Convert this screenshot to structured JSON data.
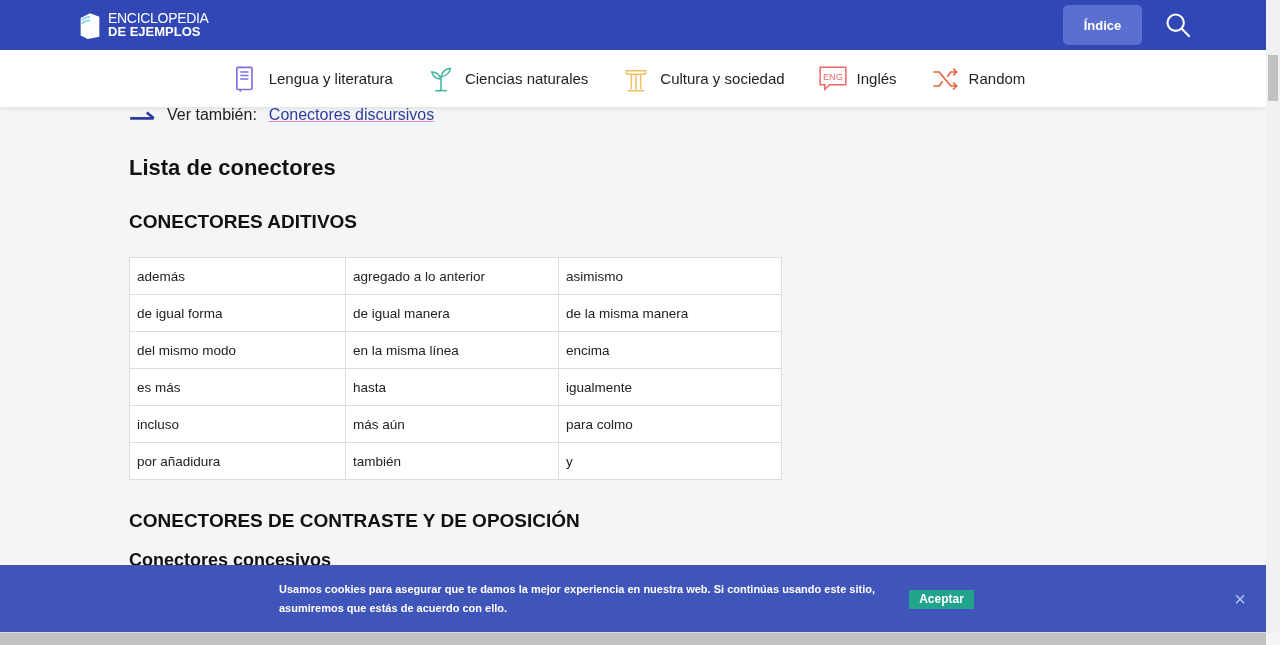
{
  "header": {
    "logo": {
      "line_1": "ENCICLOPEDIA",
      "line_2": "DE EJEMPLOS"
    },
    "index_button": "Índice"
  },
  "nav": [
    {
      "label": "Lengua y literatura",
      "kind": "book",
      "color": "#7b6fe0"
    },
    {
      "label": "Ciencias naturales",
      "kind": "plant",
      "color": "#3fb4a0"
    },
    {
      "label": "Cultura y sociedad",
      "kind": "column",
      "color": "#f0c060"
    },
    {
      "label": "Inglés",
      "kind": "eng",
      "color": "#ee6a6a",
      "icon_text": "ENG"
    },
    {
      "label": "Random",
      "kind": "shuffle",
      "color": "#e8603c"
    }
  ],
  "see_also": {
    "label": "Ver también:",
    "link": "Conectores discursivos"
  },
  "title": "Lista de conectores",
  "sections": [
    {
      "heading": "CONECTORES ADITIVOS",
      "rows": [
        [
          "además",
          "agregado a lo anterior",
          "asimismo"
        ],
        [
          "de igual forma",
          "de igual manera",
          "de la misma manera"
        ],
        [
          "del mismo modo",
          "en la misma línea",
          "encima"
        ],
        [
          "es más",
          "hasta",
          "igualmente"
        ],
        [
          "incluso",
          "más aún",
          "para colmo"
        ],
        [
          "por añadidura",
          "también",
          "y"
        ]
      ]
    },
    {
      "heading": "CONECTORES DE CONTRASTE Y DE OPOSICIÓN",
      "subheading": "Conectores concesivos"
    }
  ],
  "cookie_banner": {
    "text": "Usamos cookies para asegurar que te damos la mejor experiencia en nuestra web. Si continúas usando este sitio, asumiremos que estás de acuerdo con ello.",
    "accept": "Aceptar",
    "close": "×"
  }
}
